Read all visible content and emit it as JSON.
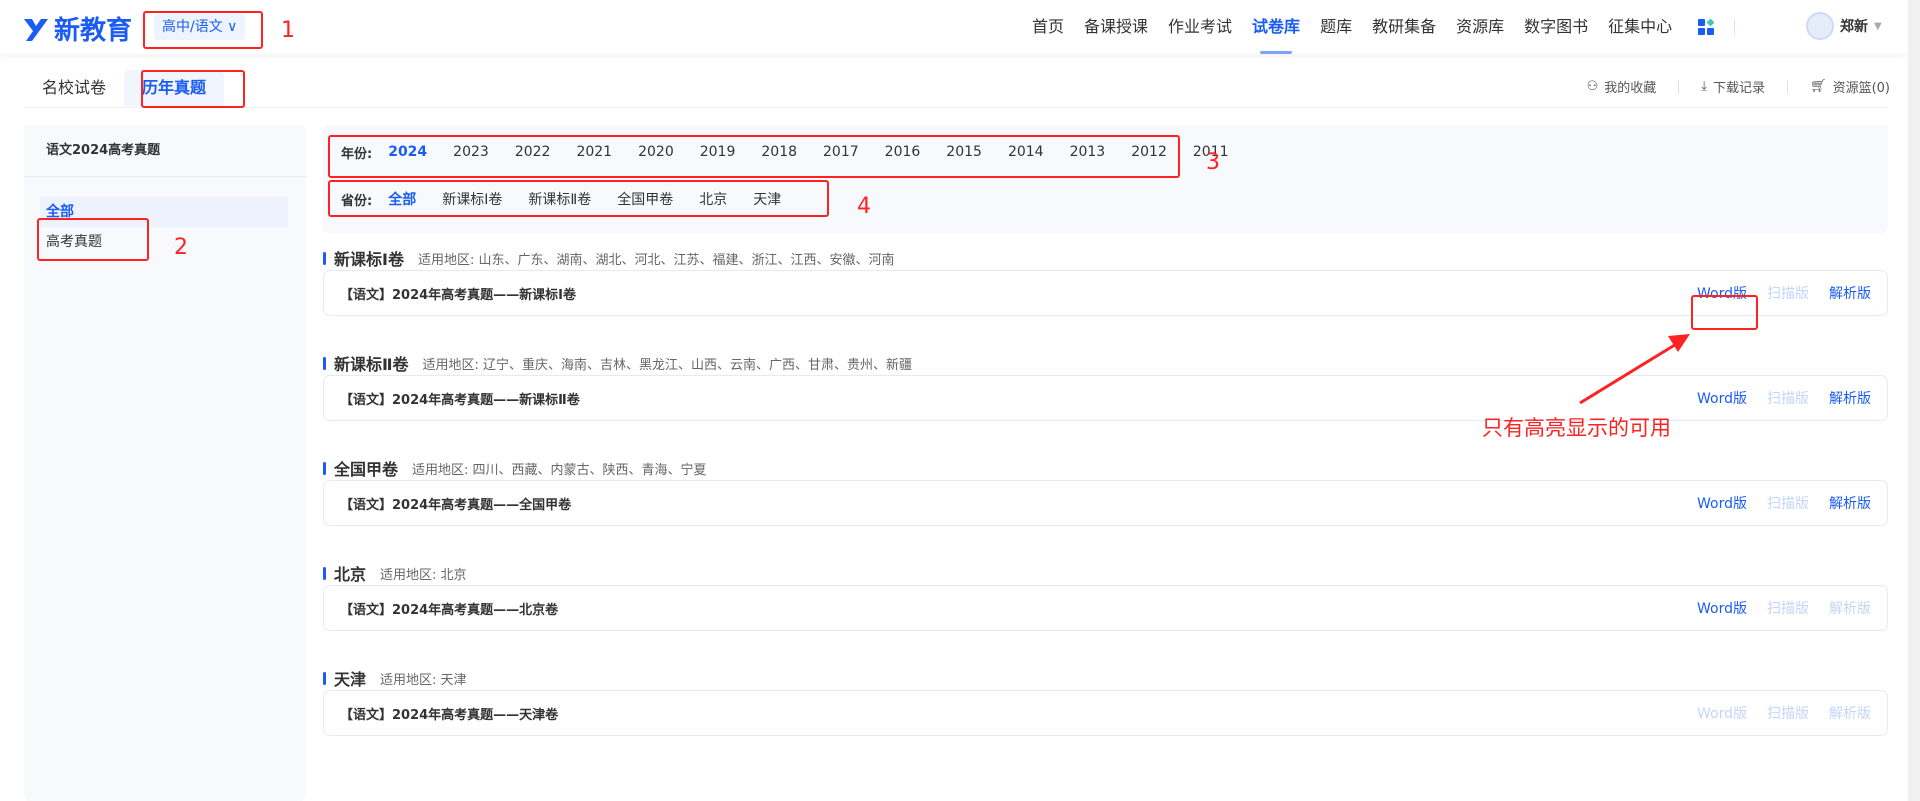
{
  "header": {
    "logo": "新教育",
    "selector": "高中/语文",
    "nav": [
      "首页",
      "备课授课",
      "作业考试",
      "试卷库",
      "题库",
      "教研集备",
      "资源库",
      "数字图书",
      "征集中心"
    ],
    "active_nav": "试卷库",
    "user": "郑新"
  },
  "tabs": [
    "名校试卷",
    "历年真题"
  ],
  "toplinks": {
    "favorites": "我的收藏",
    "downloads": "下载记录",
    "basket": "资源篮(0)"
  },
  "sidebar": {
    "title": "语文2024高考真题",
    "items": [
      "全部",
      "高考真题"
    ]
  },
  "filter": {
    "year_label": "年份:",
    "years": [
      "2024",
      "2023",
      "2022",
      "2021",
      "2020",
      "2019",
      "2018",
      "2017",
      "2016",
      "2015",
      "2014",
      "2013",
      "2012",
      "2011"
    ],
    "province_label": "省份:",
    "provinces": [
      "全部",
      "新课标Ⅰ卷",
      "新课标Ⅱ卷",
      "全国甲卷",
      "北京",
      "天津"
    ]
  },
  "sections": [
    {
      "name": "新课标Ⅰ卷",
      "region": "适用地区: 山东、广东、湖南、湖北、河北、江苏、福建、浙江、江西、安徽、河南",
      "title": "【语文】2024年高考真题——新课标Ⅰ卷",
      "word": "Word版",
      "scan": "扫描版",
      "analysis": "解析版",
      "word_on": true,
      "scan_on": false,
      "analysis_on": true
    },
    {
      "name": "新课标Ⅱ卷",
      "region": "适用地区: 辽宁、重庆、海南、吉林、黑龙江、山西、云南、广西、甘肃、贵州、新疆",
      "title": "【语文】2024年高考真题——新课标Ⅱ卷",
      "word": "Word版",
      "scan": "扫描版",
      "analysis": "解析版",
      "word_on": true,
      "scan_on": false,
      "analysis_on": true
    },
    {
      "name": "全国甲卷",
      "region": "适用地区: 四川、西藏、内蒙古、陕西、青海、宁夏",
      "title": "【语文】2024年高考真题——全国甲卷",
      "word": "Word版",
      "scan": "扫描版",
      "analysis": "解析版",
      "word_on": true,
      "scan_on": false,
      "analysis_on": true
    },
    {
      "name": "北京",
      "region": "适用地区: 北京",
      "title": "【语文】2024年高考真题——北京卷",
      "word": "Word版",
      "scan": "扫描版",
      "analysis": "解析版",
      "word_on": true,
      "scan_on": false,
      "analysis_on": false
    },
    {
      "name": "天津",
      "region": "适用地区: 天津",
      "title": "【语文】2024年高考真题——天津卷",
      "word": "Word版",
      "scan": "扫描版",
      "analysis": "解析版",
      "word_on": false,
      "scan_on": false,
      "analysis_on": false
    }
  ],
  "annotations": {
    "labels": [
      "1",
      "2",
      "3",
      "4"
    ],
    "note": "只有高亮显示的可用",
    "color": "#ff2222"
  }
}
